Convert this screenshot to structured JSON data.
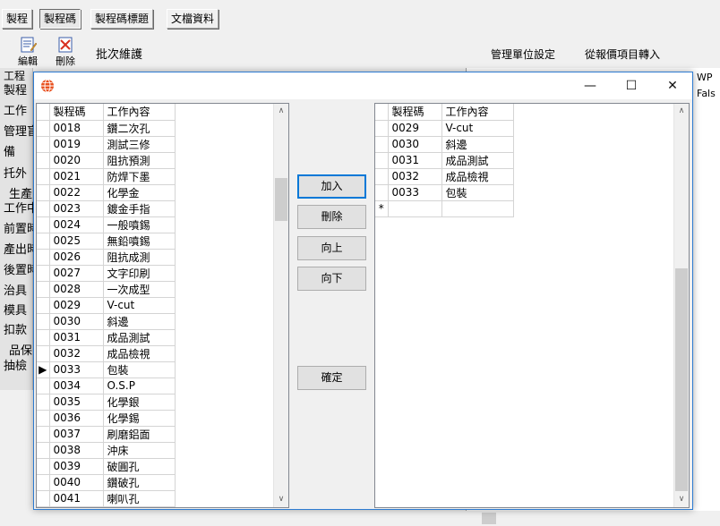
{
  "top_tabs": [
    "製程",
    "製程碼",
    "製程碼標題",
    "文檔資料"
  ],
  "toolbar": {
    "edit_label": "編輯",
    "delete_label": "刪除",
    "section_title": "批次維護"
  },
  "right_header": {
    "mgmt_unit": "管理單位設定",
    "import_price": "從報價項目轉入",
    "col_wp": "WP",
    "col_false": "Fals"
  },
  "left_labels": [
    "工程",
    "製程",
    "工作",
    "管理盲",
    "備",
    "托外",
    "生產",
    "工作中",
    "前置時",
    "產出時",
    "後置時",
    "治具",
    "模具",
    "扣款",
    "品保",
    "抽檢"
  ],
  "dialog": {
    "icon": "globe-icon",
    "minimize": "—",
    "maximize": "☐",
    "close": "✕",
    "left_grid": {
      "headers": [
        "製程碼",
        "工作內容"
      ],
      "current_row_index": 15,
      "rows": [
        {
          "code": "0018",
          "desc": "鑽二次孔"
        },
        {
          "code": "0019",
          "desc": "測試三修"
        },
        {
          "code": "0020",
          "desc": "阻抗預測"
        },
        {
          "code": "0021",
          "desc": "防焊下墨"
        },
        {
          "code": "0022",
          "desc": "化學金"
        },
        {
          "code": "0023",
          "desc": "鍍金手指"
        },
        {
          "code": "0024",
          "desc": "一般噴錫"
        },
        {
          "code": "0025",
          "desc": "無鉛噴錫"
        },
        {
          "code": "0026",
          "desc": "阻抗成測"
        },
        {
          "code": "0027",
          "desc": "文字印刷"
        },
        {
          "code": "0028",
          "desc": "一次成型"
        },
        {
          "code": "0029",
          "desc": "V-cut"
        },
        {
          "code": "0030",
          "desc": "斜邊"
        },
        {
          "code": "0031",
          "desc": "成品測試"
        },
        {
          "code": "0032",
          "desc": "成品檢視"
        },
        {
          "code": "0033",
          "desc": "包裝"
        },
        {
          "code": "0034",
          "desc": "O.S.P"
        },
        {
          "code": "0035",
          "desc": "化學銀"
        },
        {
          "code": "0036",
          "desc": "化學錫"
        },
        {
          "code": "0037",
          "desc": "刷磨鋁面"
        },
        {
          "code": "0038",
          "desc": "沖床"
        },
        {
          "code": "0039",
          "desc": "破圓孔"
        },
        {
          "code": "0040",
          "desc": "鑽破孔"
        },
        {
          "code": "0041",
          "desc": "喇叭孔"
        }
      ]
    },
    "buttons": {
      "add": "加入",
      "remove": "刪除",
      "up": "向上",
      "down": "向下",
      "confirm": "確定"
    },
    "right_grid": {
      "headers": [
        "製程碼",
        "工作內容"
      ],
      "new_row_marker": "*",
      "rows": [
        {
          "code": "0029",
          "desc": "V-cut"
        },
        {
          "code": "0030",
          "desc": "斜邊"
        },
        {
          "code": "0031",
          "desc": "成品測試"
        },
        {
          "code": "0032",
          "desc": "成品檢視"
        },
        {
          "code": "0033",
          "desc": "包裝"
        }
      ]
    }
  }
}
